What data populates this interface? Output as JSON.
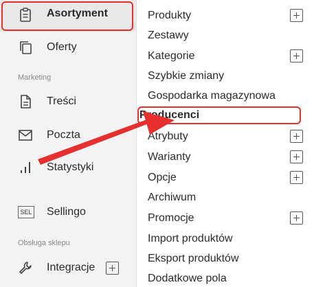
{
  "sidebar": {
    "items": [
      {
        "label": "Asortyment",
        "icon": "clipboard-icon",
        "active": true
      },
      {
        "label": "Oferty",
        "icon": "copy-icon"
      },
      {
        "label": "Treści",
        "icon": "document-icon"
      },
      {
        "label": "Poczta",
        "icon": "mail-icon"
      },
      {
        "label": "Statystyki",
        "icon": "bar-chart-icon"
      },
      {
        "label": "Sellingo",
        "icon": "sel-badge-icon"
      },
      {
        "label": "Integracje",
        "icon": "wrench-icon"
      }
    ],
    "sections": {
      "marketing": "Marketing",
      "store": "Obsługa sklepu"
    },
    "sel_badge": "SEL"
  },
  "submenu": {
    "items": [
      {
        "label": "Produkty",
        "expandable": true
      },
      {
        "label": "Zestawy",
        "expandable": false
      },
      {
        "label": "Kategorie",
        "expandable": true
      },
      {
        "label": "Szybkie zmiany",
        "expandable": false
      },
      {
        "label": "Gospodarka magazynowa",
        "expandable": false
      },
      {
        "label": "Producenci",
        "expandable": false,
        "highlighted": true
      },
      {
        "label": "Atrybuty",
        "expandable": true
      },
      {
        "label": "Warianty",
        "expandable": true
      },
      {
        "label": "Opcje",
        "expandable": true
      },
      {
        "label": "Archiwum",
        "expandable": false
      },
      {
        "label": "Promocje",
        "expandable": true
      },
      {
        "label": "Import produktów",
        "expandable": false
      },
      {
        "label": "Eksport produktów",
        "expandable": false
      },
      {
        "label": "Dodatkowe pola",
        "expandable": false
      }
    ]
  },
  "colors": {
    "annotation": "#e63030",
    "sidebar_bg": "#f3f3f3",
    "active_bg": "#e8e8e8"
  }
}
